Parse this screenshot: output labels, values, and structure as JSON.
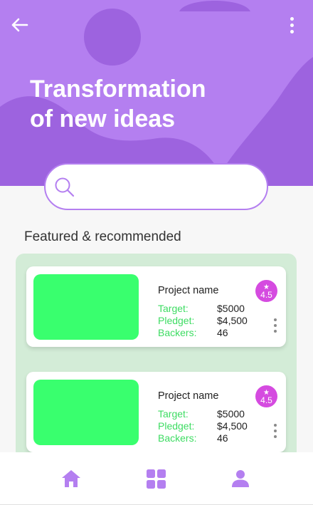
{
  "header": {
    "title_line1": "Transformation",
    "title_line2": "of new ideas",
    "back_icon": "arrow-left-icon",
    "more_icon": "more-vertical-icon",
    "bg_color": "#b47ff0"
  },
  "search": {
    "placeholder": "",
    "value": "",
    "icon": "search-icon"
  },
  "featured": {
    "title": "Featured & recommended",
    "projects": [
      {
        "name": "Project name",
        "target_label": "Target:",
        "target_value": "$5000",
        "pledged_label": "Pledget:",
        "pledged_value": "$4,500",
        "backers_label": "Backers:",
        "backers_value": "46",
        "rating": "4.5"
      },
      {
        "name": "Project name",
        "target_label": "Target:",
        "target_value": "$5000",
        "pledged_label": "Pledget:",
        "pledged_value": "$4,500",
        "backers_label": "Backers:",
        "backers_value": "46",
        "rating": "4.5"
      }
    ]
  },
  "nav": {
    "items": [
      "home-icon",
      "dashboard-icon",
      "profile-icon"
    ],
    "icon_color": "#b47ff0"
  },
  "colors": {
    "accent": "#b47ff0",
    "thumb": "#39ff6e",
    "stat_label": "#3ddc62",
    "rating_badge": "#d54be0",
    "featured_bg": "#d3ecd7"
  }
}
